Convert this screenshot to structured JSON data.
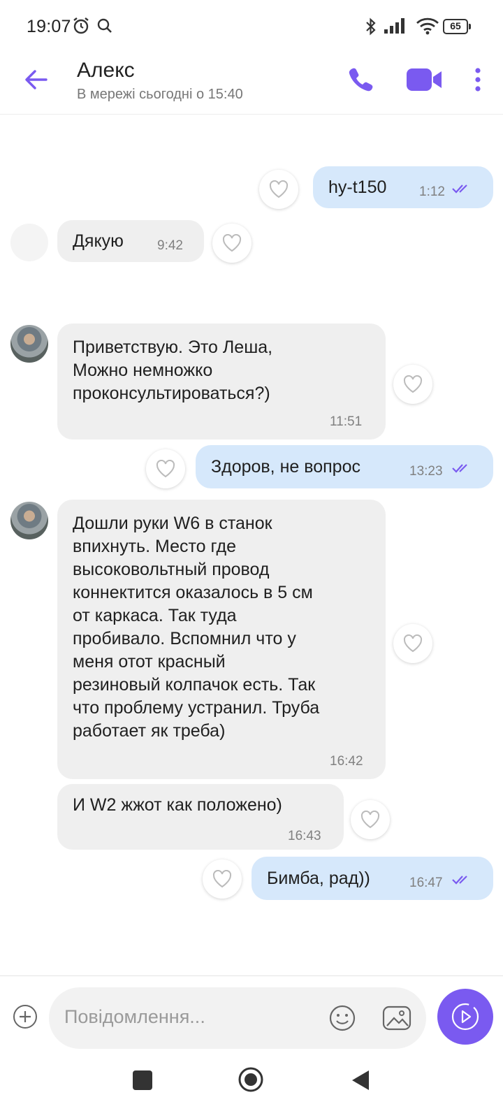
{
  "status_bar": {
    "time": "19:07",
    "battery": "65"
  },
  "header": {
    "contact_name": "Алекс",
    "contact_status": "В мережі сьогодні о 15:40"
  },
  "messages": [
    {
      "direction": "out",
      "text": "hy-t150",
      "time": "1:12",
      "read": true
    },
    {
      "direction": "in",
      "text": "Дякую",
      "time": "9:42"
    },
    {
      "direction": "in",
      "text": "Приветствую. Это Леша,\nМожно немножко\nпроконсультироваться?)",
      "time": "11:51"
    },
    {
      "direction": "out",
      "text": "Здоров, не вопрос",
      "time": "13:23",
      "read": true
    },
    {
      "direction": "in",
      "text": "Дошли руки W6 в станок\nвпихнуть. Место где\nвысоковольтный провод\nконнектится оказалось в 5 см\nот каркаса. Так туда\nпробивало. Вспомнил что у\nменя отот красный\nрезиновый колпачок есть. Так\nчто проблему устранил. Труба\nработает як треба)",
      "time": "16:42"
    },
    {
      "direction": "in",
      "text": "И W2 жжот как положено)",
      "time": "16:43"
    },
    {
      "direction": "out",
      "text": "Бимба, рад))",
      "time": "16:47",
      "read": true
    }
  ],
  "composer": {
    "placeholder": "Повідомлення..."
  },
  "colors": {
    "accent": "#7a5af0",
    "incoming_bubble": "#efefef",
    "outgoing_bubble": "#d6e8fb"
  }
}
